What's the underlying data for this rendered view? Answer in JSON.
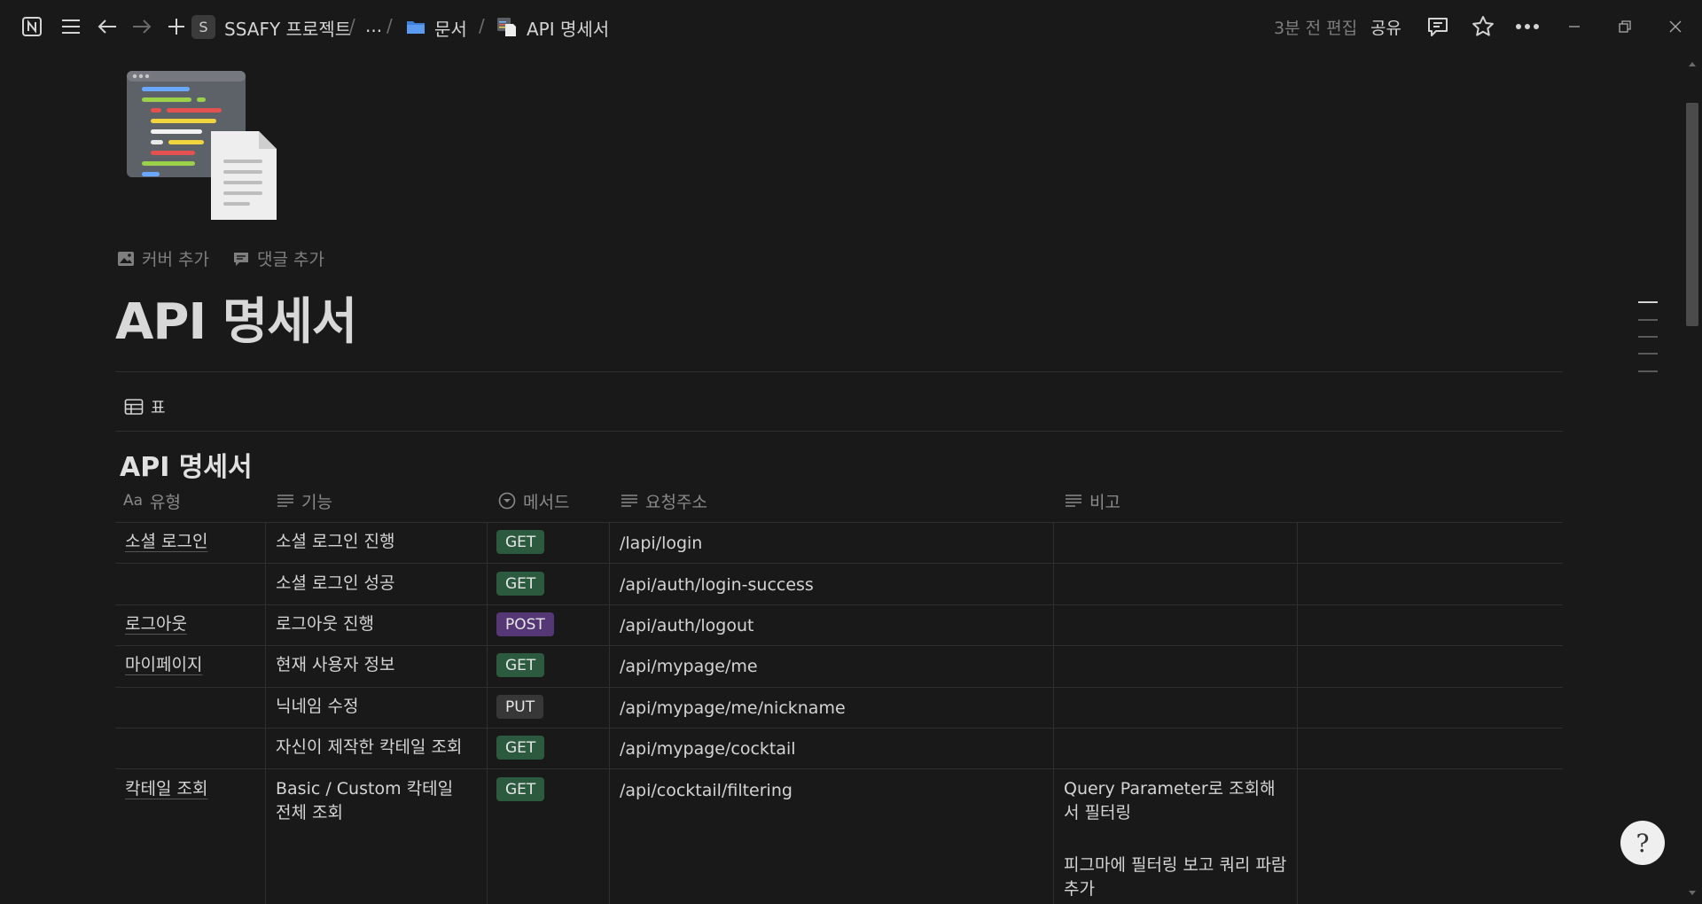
{
  "breadcrumb": {
    "workspace_initial": "S",
    "workspace": "SSAFY 프로젝트",
    "ellipsis": "...",
    "folder": "문서",
    "page": "API 명세서"
  },
  "topbar": {
    "edited": "3분 전 편집",
    "share": "공유"
  },
  "page": {
    "add_cover": "커버 추가",
    "add_comment": "댓글 추가",
    "title": "API 명세서"
  },
  "view": {
    "tab_label": "표"
  },
  "database": {
    "title": "API 명세서",
    "columns": {
      "type": "유형",
      "type_prefix": "Aa",
      "feature": "기능",
      "method": "메서드",
      "url": "요청주소",
      "note": "비고"
    },
    "rows": [
      {
        "type": "소셜 로그인",
        "feature": "소셜 로그인 진행",
        "method": "GET",
        "url": "/lapi/login",
        "note": ""
      },
      {
        "type": "",
        "feature": "소셜 로그인 성공",
        "method": "GET",
        "url": "/api/auth/login-success",
        "note": ""
      },
      {
        "type": "로그아웃",
        "feature": "로그아웃 진행",
        "method": "POST",
        "url": "/api/auth/logout",
        "note": ""
      },
      {
        "type": "마이페이지",
        "feature": "현재 사용자 정보",
        "method": "GET",
        "url": "/api/mypage/me",
        "note": ""
      },
      {
        "type": "",
        "feature": "닉네임 수정",
        "method": "PUT",
        "url": "/api/mypage/me/nickname",
        "note": ""
      },
      {
        "type": "",
        "feature": "자신이 제작한 칵테일 조회",
        "method": "GET",
        "url": "/api/mypage/cocktail",
        "note": ""
      },
      {
        "type": "칵테일 조회",
        "feature": "Basic / Custom 칵테일 전체 조회",
        "method": "GET",
        "url": "/api/cocktail/filtering",
        "note": "Query Parameter로 조회해서 필터링",
        "note2": "피그마에 필터링 보고 쿼리 파람 추가"
      }
    ]
  },
  "colors": {
    "background": "#191919",
    "get": "#2b5a3f",
    "post": "#553775",
    "put": "#373737"
  },
  "help": {
    "glyph": "?"
  }
}
